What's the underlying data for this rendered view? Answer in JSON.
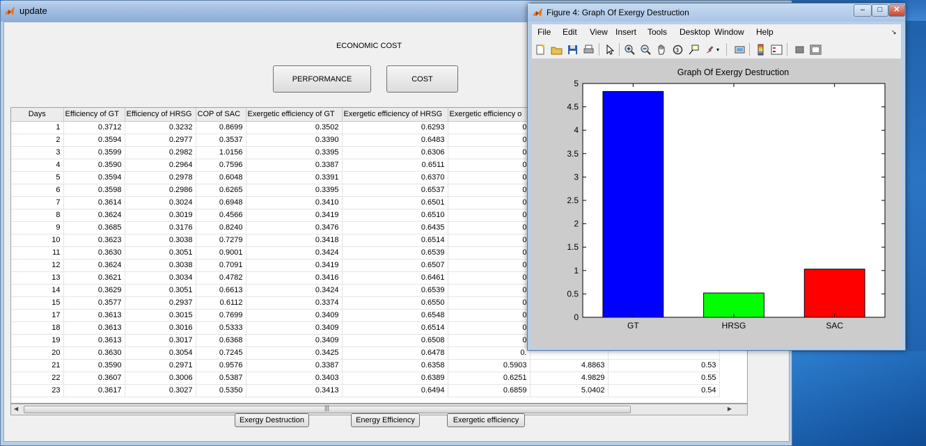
{
  "main_window": {
    "title": "update",
    "heading": "ECONOMIC COST",
    "buttons": {
      "performance": "PERFORMANCE",
      "cost": "COST",
      "exergy_destruction": "Exergy Destruction",
      "energy_efficiency": "Energy Efficiency",
      "exergetic_efficiency": "Exergetic efficiency"
    },
    "table": {
      "headers": [
        "Days",
        "Efficiency of GT",
        "Efficiency of HRSG",
        "COP of SAC",
        "Exergetic efficiency of GT",
        "Exergetic efficiency of HRSG",
        "Exergetic efficiency o"
      ],
      "rows": [
        [
          "1",
          "0.3712",
          "0.3232",
          "0.8699",
          "0.3502",
          "0.6293",
          "0",
          "",
          ""
        ],
        [
          "2",
          "0.3594",
          "0.2977",
          "0.3537",
          "0.3390",
          "0.6483",
          "0",
          "",
          ""
        ],
        [
          "3",
          "0.3599",
          "0.2982",
          "1.0156",
          "0.3395",
          "0.6306",
          "0",
          "",
          ""
        ],
        [
          "4",
          "0.3590",
          "0.2964",
          "0.7596",
          "0.3387",
          "0.6511",
          "0",
          "",
          ""
        ],
        [
          "5",
          "0.3594",
          "0.2978",
          "0.6048",
          "0.3391",
          "0.6370",
          "0",
          "",
          ""
        ],
        [
          "6",
          "0.3598",
          "0.2986",
          "0.6265",
          "0.3395",
          "0.6537",
          "0",
          "",
          ""
        ],
        [
          "7",
          "0.3614",
          "0.3024",
          "0.6948",
          "0.3410",
          "0.6501",
          "0",
          "",
          ""
        ],
        [
          "8",
          "0.3624",
          "0.3019",
          "0.4566",
          "0.3419",
          "0.6510",
          "0",
          "",
          ""
        ],
        [
          "9",
          "0.3685",
          "0.3176",
          "0.8240",
          "0.3476",
          "0.6435",
          "0",
          "",
          ""
        ],
        [
          "10",
          "0.3623",
          "0.3038",
          "0.7279",
          "0.3418",
          "0.6514",
          "0",
          "",
          ""
        ],
        [
          "11",
          "0.3630",
          "0.3051",
          "0.9001",
          "0.3424",
          "0.6539",
          "0",
          "",
          ""
        ],
        [
          "12",
          "0.3624",
          "0.3038",
          "0.7091",
          "0.3419",
          "0.6507",
          "0",
          "",
          ""
        ],
        [
          "13",
          "0.3621",
          "0.3034",
          "0.4782",
          "0.3416",
          "0.6461",
          "0",
          "",
          ""
        ],
        [
          "14",
          "0.3629",
          "0.3051",
          "0.6613",
          "0.3424",
          "0.6539",
          "0",
          "",
          ""
        ],
        [
          "15",
          "0.3577",
          "0.2937",
          "0.6112",
          "0.3374",
          "0.6550",
          "0",
          "",
          ""
        ],
        [
          "17",
          "0.3613",
          "0.3015",
          "0.7699",
          "0.3409",
          "0.6548",
          "0",
          "",
          ""
        ],
        [
          "18",
          "0.3613",
          "0.3016",
          "0.5333",
          "0.3409",
          "0.6514",
          "0",
          "",
          ""
        ],
        [
          "19",
          "0.3613",
          "0.3017",
          "0.6368",
          "0.3409",
          "0.6508",
          "0",
          "",
          ""
        ],
        [
          "20",
          "0.3630",
          "0.3054",
          "0.7245",
          "0.3425",
          "0.6478",
          "0.",
          "",
          ""
        ],
        [
          "21",
          "0.3590",
          "0.2971",
          "0.9576",
          "0.3387",
          "0.6358",
          "0.5903",
          "4.8863",
          "0.53"
        ],
        [
          "22",
          "0.3607",
          "0.3006",
          "0.5387",
          "0.3403",
          "0.6389",
          "0.6251",
          "4.9829",
          "0.55"
        ],
        [
          "23",
          "0.3617",
          "0.3027",
          "0.5350",
          "0.3413",
          "0.6494",
          "0.6859",
          "5.0402",
          "0.54"
        ]
      ]
    }
  },
  "figure_window": {
    "title": "Figure 4: Graph Of Exergy Destruction",
    "menu": [
      "File",
      "Edit",
      "View",
      "Insert",
      "Tools",
      "Desktop",
      "Window",
      "Help"
    ],
    "toolbar_icons": [
      "new-file-icon",
      "open-folder-icon",
      "save-icon",
      "print-icon",
      "pointer-icon",
      "zoom-in-icon",
      "zoom-out-icon",
      "pan-hand-icon",
      "rotate-3d-icon",
      "data-cursor-icon",
      "brush-icon",
      "link-plot-icon",
      "colorbar-icon",
      "legend-icon",
      "hide-tools-icon",
      "show-tools-icon"
    ]
  },
  "chart_data": {
    "type": "bar",
    "title": "Graph Of Exergy Destruction",
    "categories": [
      "GT",
      "HRSG",
      "SAC"
    ],
    "values": [
      4.83,
      0.52,
      1.03
    ],
    "colors": [
      "#0000ff",
      "#00ff00",
      "#ff0000"
    ],
    "ylim": [
      0,
      5
    ],
    "yticks": [
      "0",
      "0.5",
      "1",
      "1.5",
      "2",
      "2.5",
      "3",
      "3.5",
      "4",
      "4.5",
      "5"
    ],
    "xlabel": "",
    "ylabel": "",
    "grid": false
  }
}
